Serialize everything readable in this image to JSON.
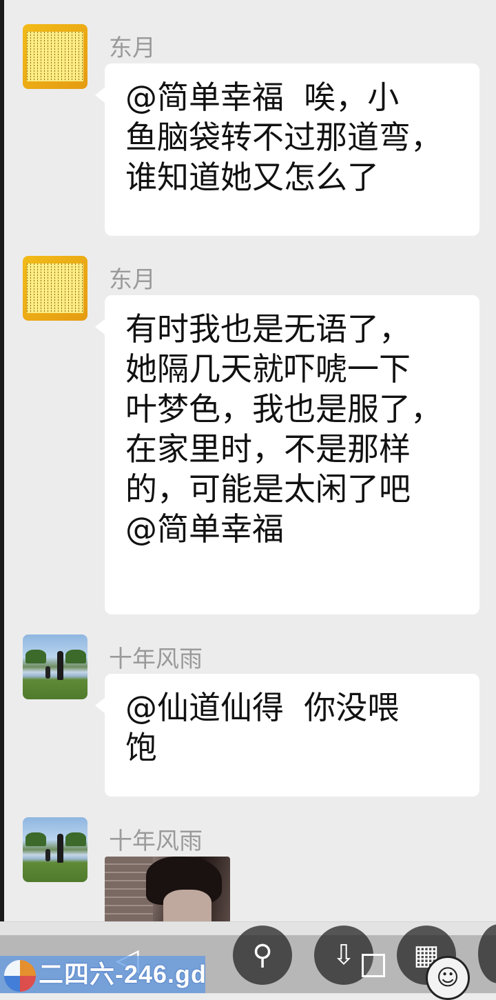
{
  "messages": [
    {
      "sender": "东月",
      "avatar": "scripture-scroll-avatar",
      "text": "@简单幸福  唉，小\n鱼脑袋转不过那道弯，\n谁知道她又怎么了"
    },
    {
      "sender": "东月",
      "avatar": "scripture-scroll-avatar",
      "text": "有时我也是无语了，\n她隔几天就吓唬一下\n叶梦色，我也是服了，\n在家里时，不是那样\n的，可能是太闲了吧\n@简单幸福"
    },
    {
      "sender": "十年风雨",
      "avatar": "park-photo-avatar",
      "text": "@仙道仙得  你没喂\n饱"
    },
    {
      "sender": "十年风雨",
      "avatar": "park-photo-avatar",
      "image": "portrait-photo"
    }
  ],
  "toolbar": {
    "icons": [
      "back-arrow-icon",
      "bicycle-icon",
      "download-icon",
      "grid-icon",
      "emoji-icon"
    ],
    "back_glyph": "◁",
    "bike_glyph": "⚲",
    "download_glyph": "⇩",
    "grid_glyph": "▦",
    "emoji_glyph": "☺"
  },
  "watermark": {
    "text": "二四六-246.gd"
  }
}
